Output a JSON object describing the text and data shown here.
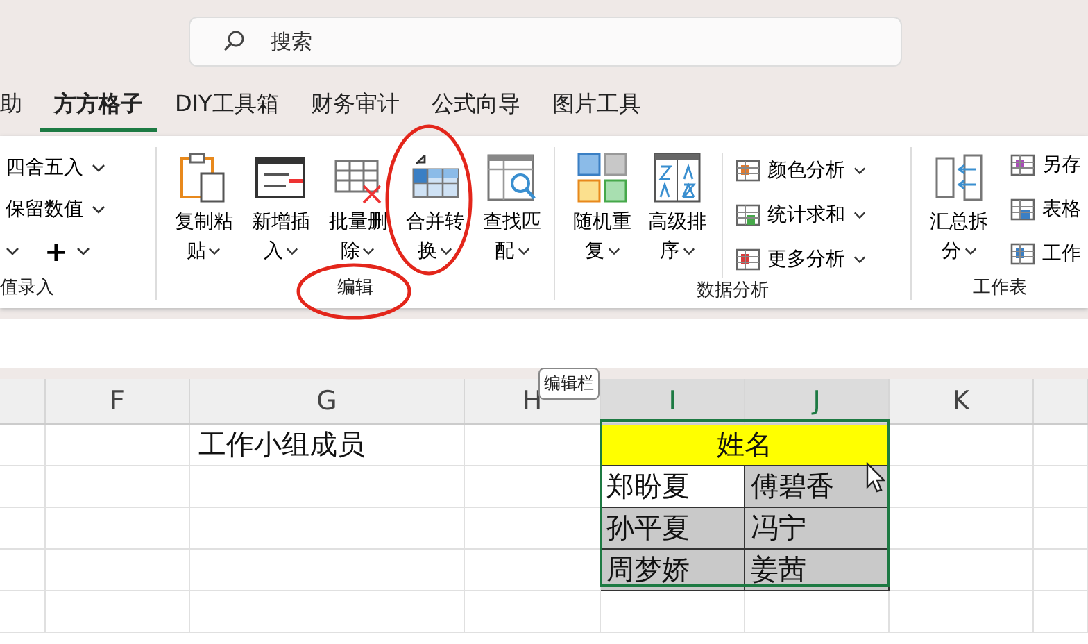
{
  "search": {
    "placeholder": "搜索"
  },
  "tabs": [
    {
      "label": "助",
      "selected": false
    },
    {
      "label": "方方格子",
      "selected": true
    },
    {
      "label": "DIY工具箱",
      "selected": false
    },
    {
      "label": "财务审计",
      "selected": false
    },
    {
      "label": "公式向导",
      "selected": false
    },
    {
      "label": "图片工具",
      "selected": false
    }
  ],
  "ribbon": {
    "groups": [
      {
        "kind": "partial",
        "label": "值录入",
        "rows": [
          {
            "label": "四舍五入"
          },
          {
            "label": "保留数值"
          },
          {
            "label": "+"
          }
        ]
      },
      {
        "kind": "large",
        "label": "编辑",
        "buttons": [
          {
            "label": "复制粘贴"
          },
          {
            "label": "新增插入"
          },
          {
            "label": "批量删除"
          },
          {
            "label": "合并转换"
          },
          {
            "label": "查找匹配"
          }
        ]
      },
      {
        "kind": "mixed",
        "label": "数据分析",
        "buttons": [
          {
            "label": "随机重复"
          },
          {
            "label": "高级排序"
          }
        ],
        "small": [
          {
            "label": "颜色分析"
          },
          {
            "label": "统计求和"
          },
          {
            "label": "更多分析"
          }
        ]
      },
      {
        "kind": "mixed",
        "label": "工作表",
        "buttons": [
          {
            "label": "汇总拆分"
          }
        ],
        "small": [
          {
            "label": "另存"
          },
          {
            "label": "表格"
          },
          {
            "label": "工作"
          }
        ]
      }
    ]
  },
  "tooltip": "编辑栏",
  "sheet": {
    "columns": [
      {
        "label": "F",
        "selected": false
      },
      {
        "label": "G",
        "selected": false
      },
      {
        "label": "H",
        "selected": false
      },
      {
        "label": "I",
        "selected": true
      },
      {
        "label": "J",
        "selected": true
      },
      {
        "label": "K",
        "selected": false
      }
    ],
    "title_cell": "工作小组成员",
    "header_cell": "姓名",
    "name_rows": [
      {
        "cells": [
          {
            "text": "郑盼夏",
            "shaded": false
          },
          {
            "text": "傅碧香",
            "shaded": true
          }
        ]
      },
      {
        "cells": [
          {
            "text": "孙平夏",
            "shaded": true
          },
          {
            "text": "冯宁",
            "shaded": true
          }
        ]
      },
      {
        "cells": [
          {
            "text": "周梦娇",
            "shaded": true
          },
          {
            "text": "姜茜",
            "shaded": true
          }
        ]
      }
    ]
  }
}
